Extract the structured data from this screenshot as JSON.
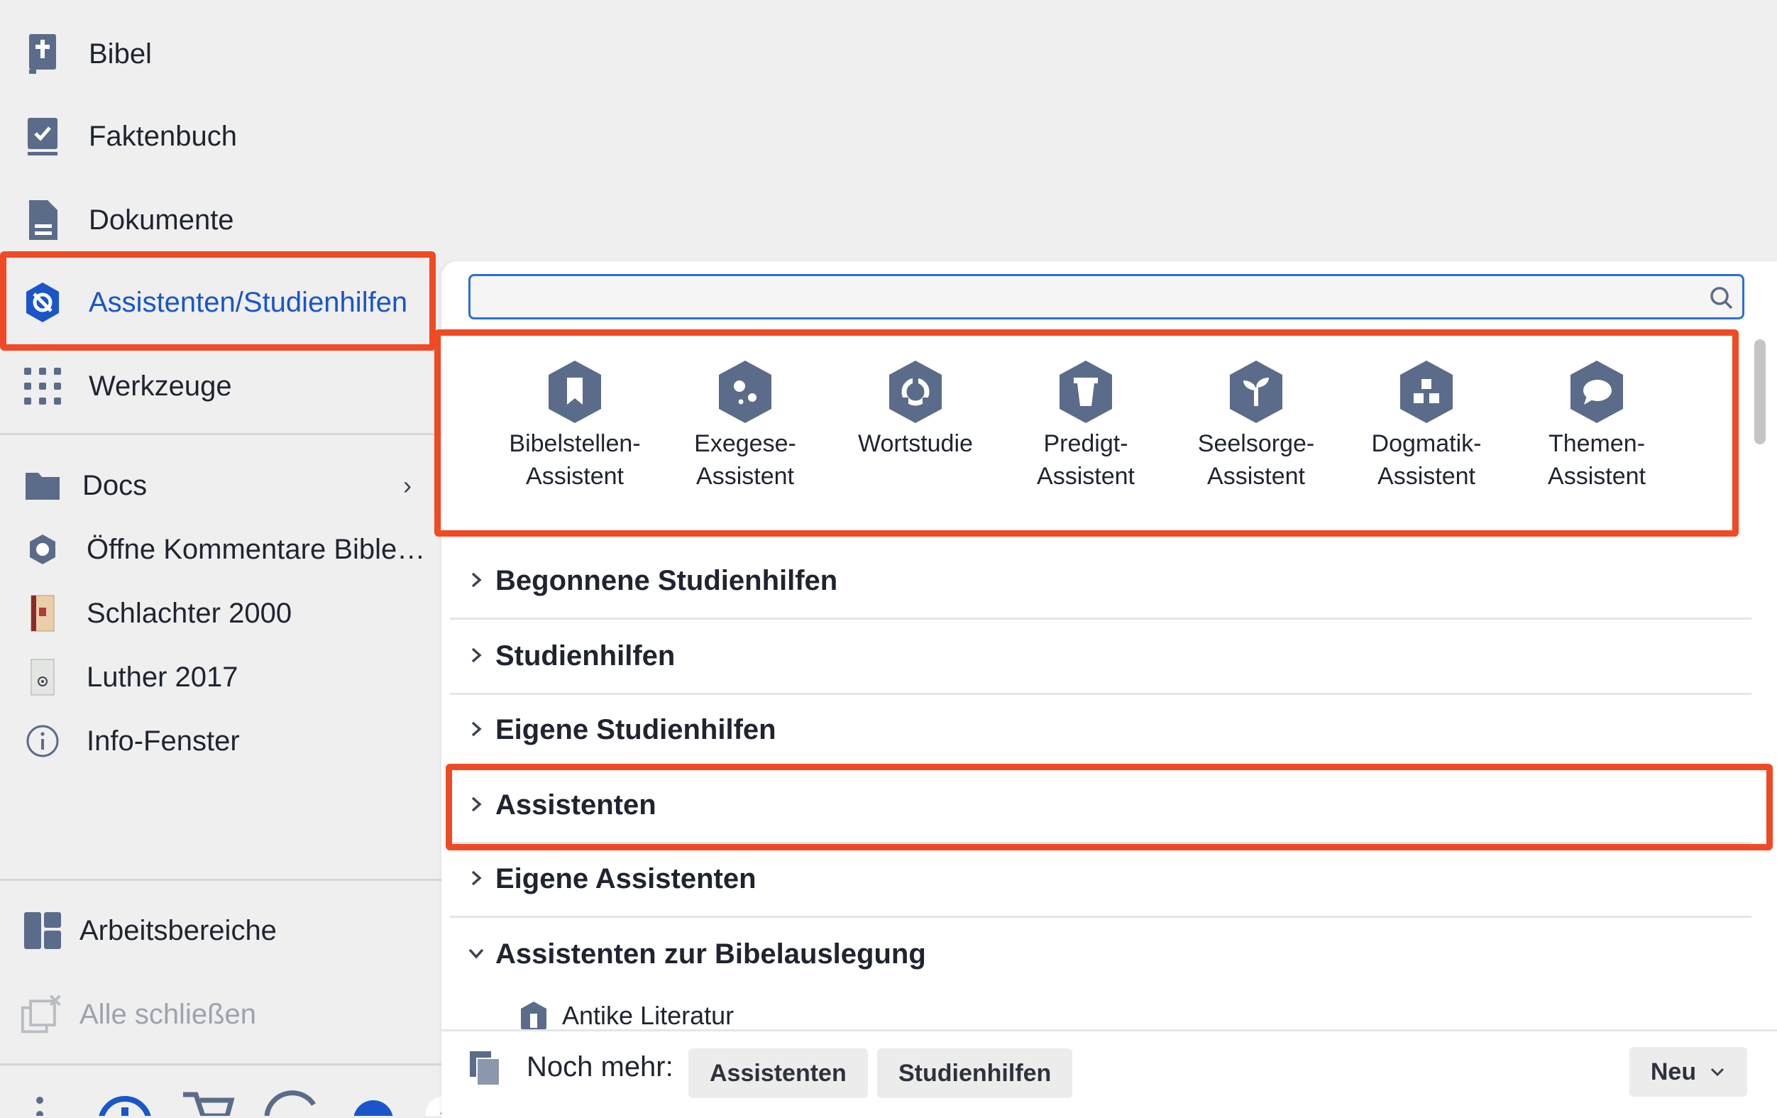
{
  "sidebar": {
    "nav": [
      {
        "label": "Bibel",
        "icon": "bible-icon"
      },
      {
        "label": "Faktenbuch",
        "icon": "factbook-icon"
      },
      {
        "label": "Dokumente",
        "icon": "document-icon"
      },
      {
        "label": "Assistenten/Studienhilfen",
        "icon": "assistant-shield-icon"
      },
      {
        "label": "Werkzeuge",
        "icon": "grid-dots-icon"
      }
    ],
    "docs": [
      {
        "label": "Docs",
        "icon": "folder-icon"
      },
      {
        "label": "Öffne Kommentare Bibletext",
        "icon": "hexagon-book-icon"
      },
      {
        "label": "Schlachter 2000",
        "icon": "book-cover-icon"
      },
      {
        "label": "Luther 2017",
        "icon": "book-cover-icon"
      },
      {
        "label": "Info-Fenster",
        "icon": "info-icon"
      }
    ],
    "workspaces_label": "Arbeitsbereiche",
    "close_all_label": "Alle schließen"
  },
  "panel": {
    "search": {
      "value": "",
      "placeholder": ""
    },
    "assistants": [
      {
        "line1": "Bibelstellen-",
        "line2": "Assistent",
        "icon": "bookmark-icon"
      },
      {
        "line1": "Exegese-",
        "line2": "Assistent",
        "icon": "dots-icon"
      },
      {
        "line1": "Wortstudie",
        "line2": "",
        "icon": "circle-icon"
      },
      {
        "line1": "Predigt-",
        "line2": "Assistent",
        "icon": "pulpit-icon"
      },
      {
        "line1": "Seelsorge-",
        "line2": "Assistent",
        "icon": "sprout-icon"
      },
      {
        "line1": "Dogmatik-",
        "line2": "Assistent",
        "icon": "blocks-icon"
      },
      {
        "line1": "Themen-",
        "line2": "Assistent",
        "icon": "speech-bubble-icon"
      }
    ],
    "sections": [
      {
        "title": "Begonnene Studienhilfen",
        "expanded": false
      },
      {
        "title": "Studienhilfen",
        "expanded": false
      },
      {
        "title": "Eigene Studienhilfen",
        "expanded": false
      },
      {
        "title": "Assistenten",
        "expanded": false
      },
      {
        "title": "Eigene Assistenten",
        "expanded": false
      },
      {
        "title": "Assistenten zur Bibelauslegung",
        "expanded": true
      }
    ],
    "sub_item": "Antike Literatur",
    "footer": {
      "label": "Noch mehr:",
      "btn_assistants": "Assistenten",
      "btn_studies": "Studienhilfen",
      "btn_new": "Neu"
    }
  },
  "colors": {
    "accent": "#1a55c9",
    "highlight": "#f04a25",
    "icon_slate": "#5b6c8a"
  }
}
